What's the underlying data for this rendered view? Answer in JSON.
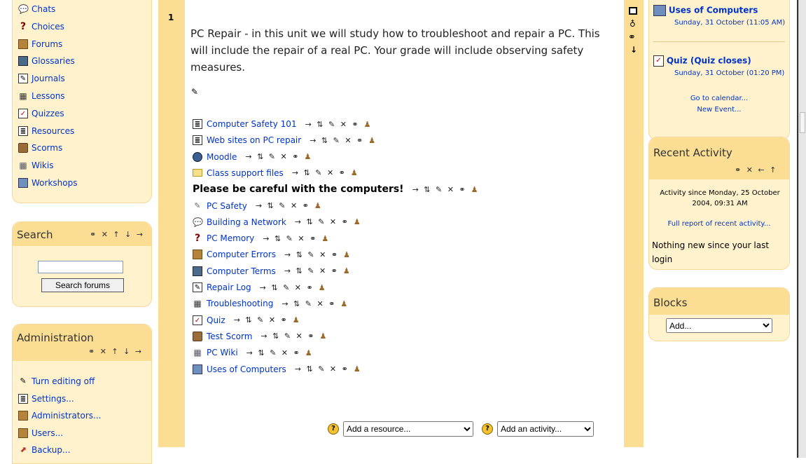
{
  "activities": {
    "items": [
      {
        "label": "Chats",
        "icon": "chat-icon"
      },
      {
        "label": "Choices",
        "icon": "question-icon"
      },
      {
        "label": "Forums",
        "icon": "forum-icon"
      },
      {
        "label": "Glossaries",
        "icon": "glossary-icon"
      },
      {
        "label": "Journals",
        "icon": "journal-icon"
      },
      {
        "label": "Lessons",
        "icon": "lesson-icon"
      },
      {
        "label": "Quizzes",
        "icon": "quiz-icon"
      },
      {
        "label": "Resources",
        "icon": "resource-icon"
      },
      {
        "label": "Scorms",
        "icon": "scorm-icon"
      },
      {
        "label": "Wikis",
        "icon": "wiki-icon"
      },
      {
        "label": "Workshops",
        "icon": "workshop-icon"
      }
    ]
  },
  "search": {
    "title": "Search",
    "controls": "⚭ ✕ ↑ ↓ →",
    "input_value": "",
    "button": "Search forums"
  },
  "admin": {
    "title": "Administration",
    "controls": "⚭ ✕ ↑ ↓ →",
    "items": [
      {
        "label": "Turn editing off",
        "icon": "pencil-icon"
      },
      {
        "label": "Settings...",
        "icon": "settings-icon"
      },
      {
        "label": "Administrators...",
        "icon": "admins-icon"
      },
      {
        "label": "Users...",
        "icon": "users-icon"
      },
      {
        "label": "Backup...",
        "icon": "backup-icon"
      }
    ]
  },
  "section": {
    "number": "1",
    "summary": "PC Repair - in this unit we will study how to troubleshoot and repair a PC. This will include the repair of a real PC. Your grade will include observing safety measures.",
    "edit_controls": "→ ⇅ ✎ ✕ ⚭",
    "items": [
      {
        "label": "Computer Safety 101",
        "icon": "resource-icon",
        "bold": false
      },
      {
        "label": "Web sites on PC repair",
        "icon": "resource-icon",
        "bold": false
      },
      {
        "label": "Moodle",
        "icon": "globe-icon",
        "bold": false
      },
      {
        "label": "Class support files",
        "icon": "folder-icon",
        "bold": false
      },
      {
        "label": "Please be careful with the computers!",
        "icon": "",
        "bold": true
      },
      {
        "label": "PC Safety",
        "icon": "assignment-icon",
        "bold": false
      },
      {
        "label": "Building a Network",
        "icon": "chat-icon",
        "bold": false
      },
      {
        "label": "PC Memory",
        "icon": "question-icon",
        "bold": false
      },
      {
        "label": "Computer Errors",
        "icon": "forum-icon",
        "bold": false
      },
      {
        "label": "Computer Terms",
        "icon": "glossary-icon",
        "bold": false
      },
      {
        "label": "Repair Log",
        "icon": "journal-icon",
        "bold": false
      },
      {
        "label": "Troubleshooting",
        "icon": "lesson-icon",
        "bold": false
      },
      {
        "label": "Quiz",
        "icon": "quiz-icon",
        "bold": false
      },
      {
        "label": "Test Scorm",
        "icon": "scorm-icon",
        "bold": false
      },
      {
        "label": "PC Wiki",
        "icon": "wiki-icon",
        "bold": false
      },
      {
        "label": "Uses of Computers",
        "icon": "workshop-icon",
        "bold": false
      }
    ],
    "add_resource": "Add a resource...",
    "add_activity": "Add an activity..."
  },
  "events": {
    "items": [
      {
        "title": "Uses of Computers",
        "date": "Sunday, 31 October (11:05 AM)"
      },
      {
        "title": "Quiz (Quiz closes)",
        "date": "Sunday, 31 October (01:20 PM)"
      }
    ],
    "goto_calendar": "Go to calendar...",
    "new_event": "New Event..."
  },
  "recent": {
    "title": "Recent Activity",
    "controls": "⚭ ✕ ← ↑",
    "since": "Activity since Monday, 25 October 2004, 09:31 AM",
    "full_report": "Full report of recent activity...",
    "nothing": "Nothing new since your last login"
  },
  "blocks": {
    "title": "Blocks",
    "select_value": "Add..."
  }
}
